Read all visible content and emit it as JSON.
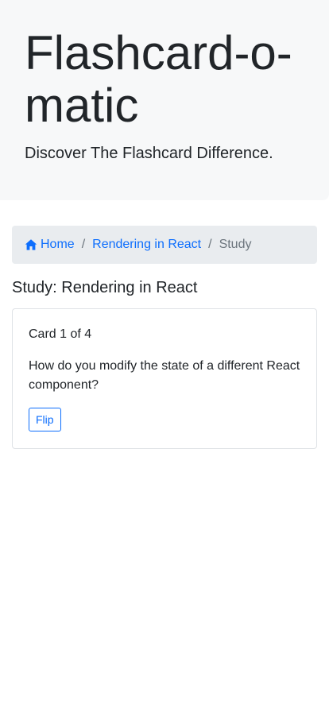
{
  "header": {
    "title": "Flashcard-o-matic",
    "lead": "Discover The Flashcard Difference."
  },
  "breadcrumb": {
    "home": "Home",
    "deck": "Rendering in React",
    "current": "Study",
    "separator": "/"
  },
  "study": {
    "heading": "Study: Rendering in React",
    "card_count": "Card 1 of 4",
    "question": "How do you modify the state of a different React component?",
    "flip_label": "Flip"
  },
  "colors": {
    "link": "#0d6efd",
    "muted": "#6c757d",
    "jumbotron_bg": "#f7f8f9",
    "breadcrumb_bg": "#e9ecef"
  },
  "icons": {
    "home": "home-icon"
  }
}
